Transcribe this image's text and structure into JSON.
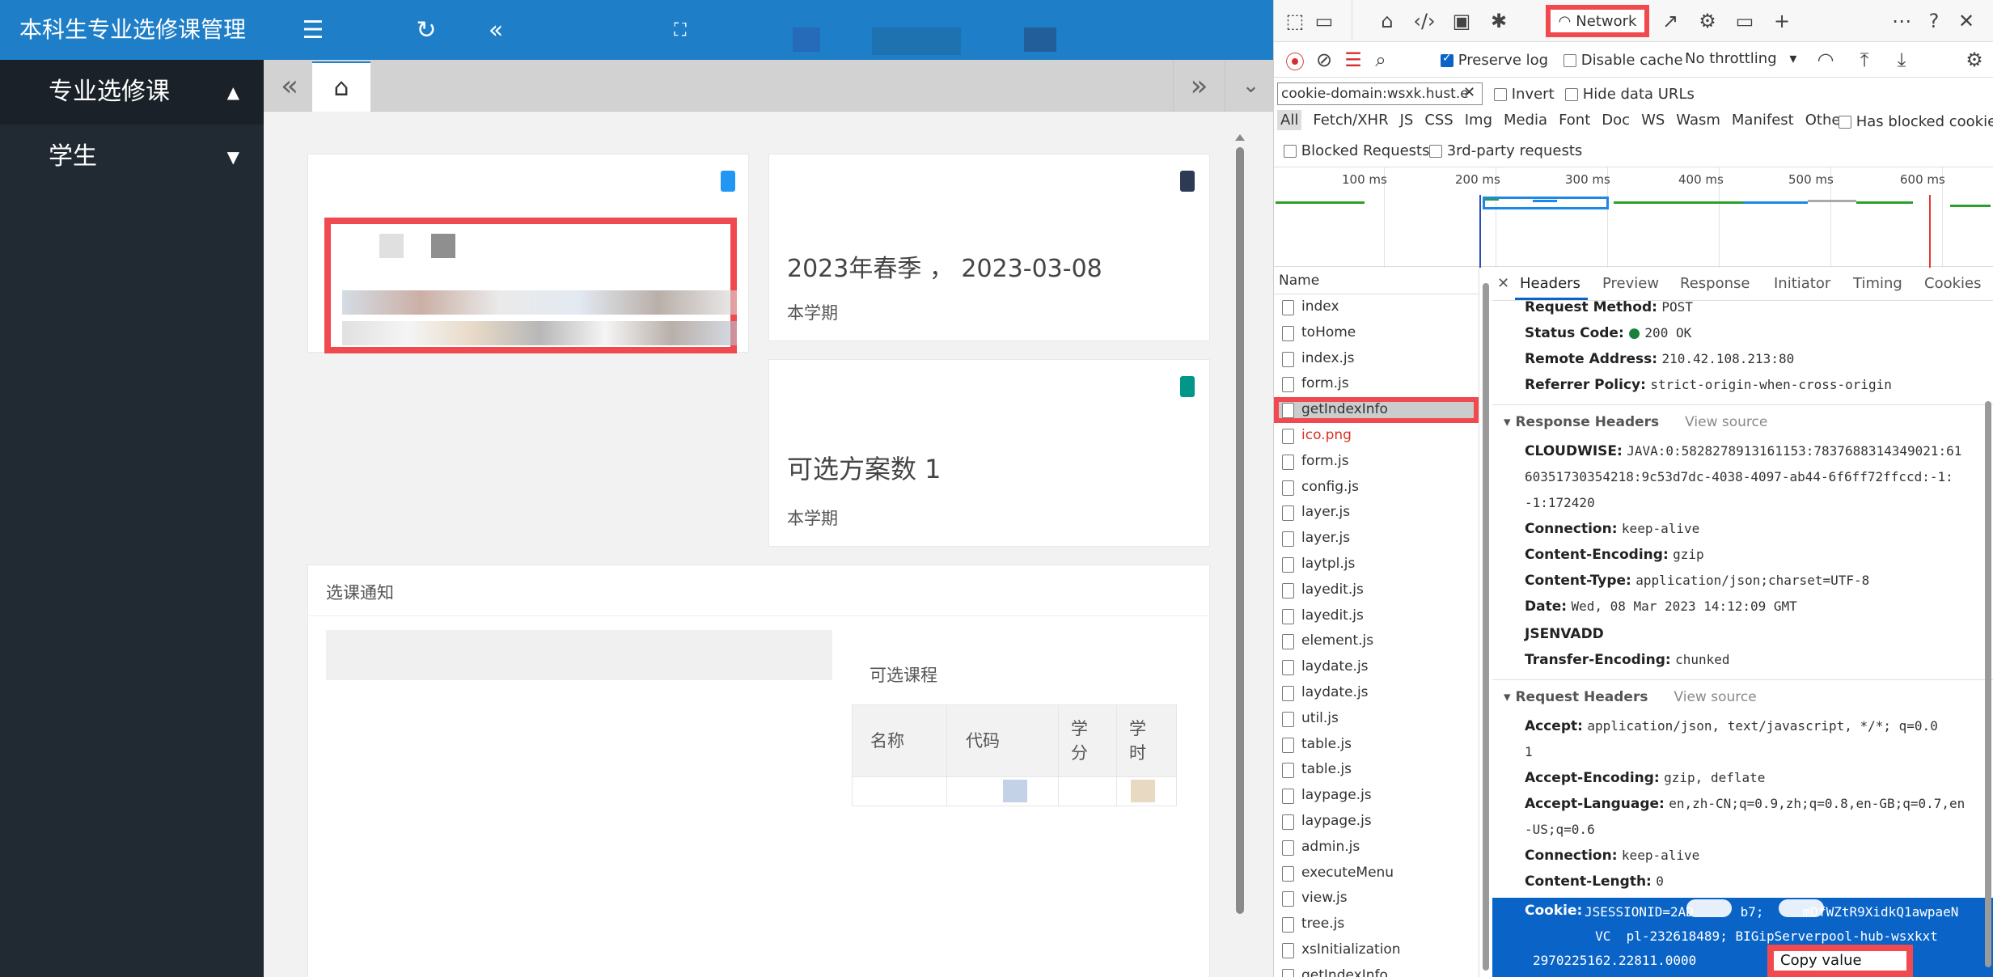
{
  "app": {
    "brand": "本科生专业选修课管理",
    "sidebar": [
      {
        "label": "专业选修课",
        "arrow": "▲"
      },
      {
        "label": "学生",
        "arrow": "▼"
      }
    ],
    "cards": {
      "term": "2023年春季 ， 2023-03-08",
      "term_sub": "本学期",
      "plans": "可选方案数 1",
      "plans_sub": "本学期"
    },
    "notice": {
      "title": "选课通知",
      "courses_title": "可选课程",
      "cols": [
        "名称",
        "代码",
        "学分",
        "学时"
      ]
    },
    "colors": {
      "accent": "#1e7ec8",
      "sidebar": "#212a33",
      "highlight": "#f04a50",
      "cookie_bg": "#0a64c8"
    }
  },
  "devtools": {
    "network_tab": "Network",
    "toolbar": {
      "preserve_log": "Preserve log",
      "disable_cache": "Disable cache",
      "throttling": "No throttling"
    },
    "filter_value": "cookie-domain:wsxk.hust.e",
    "invert": "Invert",
    "hide_data_urls": "Hide data URLs",
    "types": [
      "All",
      "Fetch/XHR",
      "JS",
      "CSS",
      "Img",
      "Media",
      "Font",
      "Doc",
      "WS",
      "Wasm",
      "Manifest",
      "Other"
    ],
    "has_blocked_cookies": "Has blocked cookies",
    "blocked_requests": "Blocked Requests",
    "third_party": "3rd-party requests",
    "timeline_labels": [
      "100 ms",
      "200 ms",
      "300 ms",
      "400 ms",
      "500 ms",
      "600 ms"
    ],
    "name_header": "Name",
    "files": [
      "index",
      "toHome",
      "index.js",
      "form.js",
      "getIndexInfo",
      "ico.png",
      "form.js",
      "config.js",
      "layer.js",
      "layer.js",
      "laytpl.js",
      "layedit.js",
      "layedit.js",
      "element.js",
      "laydate.js",
      "laydate.js",
      "util.js",
      "table.js",
      "table.js",
      "laypage.js",
      "laypage.js",
      "admin.js",
      "executeMenu",
      "view.js",
      "tree.js",
      "xsInitialization",
      "getIndexInfo"
    ],
    "detail_tabs": [
      "Headers",
      "Preview",
      "Response",
      "Initiator",
      "Timing",
      "Cookies"
    ],
    "general": [
      {
        "k": "Request Method:",
        "v": "POST"
      },
      {
        "k": "Status Code:",
        "v": "200 OK"
      },
      {
        "k": "Remote Address:",
        "v": "210.42.108.213:80"
      },
      {
        "k": "Referrer Policy:",
        "v": "strict-origin-when-cross-origin"
      }
    ],
    "response_headers_title": "Response Headers",
    "request_headers_title": "Request Headers",
    "view_source": "View source",
    "response_headers": [
      {
        "k": "CLOUDWISE:",
        "v": "JAVA:0:5828278913161153:7837688314349021:61"
      },
      {
        "k": "",
        "v": "60351730354218:9c53d7dc-4038-4097-ab44-6f6ff72ffccd:-1:"
      },
      {
        "k": "",
        "v": "-1:172420"
      },
      {
        "k": "Connection:",
        "v": "keep-alive"
      },
      {
        "k": "Content-Encoding:",
        "v": "gzip"
      },
      {
        "k": "Content-Type:",
        "v": "application/json;charset=UTF-8"
      },
      {
        "k": "Date:",
        "v": "Wed, 08 Mar 2023 14:12:09 GMT"
      },
      {
        "k": "JSENVADD",
        "v": ""
      },
      {
        "k": "Transfer-Encoding:",
        "v": "chunked"
      }
    ],
    "request_headers": [
      {
        "k": "Accept:",
        "v": "application/json, text/javascript, */*; q=0.0"
      },
      {
        "k": "",
        "v": "1"
      },
      {
        "k": "Accept-Encoding:",
        "v": "gzip, deflate"
      },
      {
        "k": "Accept-Language:",
        "v": "en,zh-CN;q=0.9,zh;q=0.8,en-GB;q=0.7,en"
      },
      {
        "k": "",
        "v": "-US;q=0.6"
      },
      {
        "k": "Connection:",
        "v": "keep-alive"
      },
      {
        "k": "Content-Length:",
        "v": "0"
      }
    ],
    "cookie_key": "Cookie:",
    "cookie_lines": [
      "JSESSIONID=2AD      b7;     mDfWZtR9XidkQ1awpaeN",
      "        VC  pl-232618489; BIGipServerpool-hub-wsxkxt",
      "2970225162.22811.0000"
    ],
    "copy_value": "Copy value"
  }
}
